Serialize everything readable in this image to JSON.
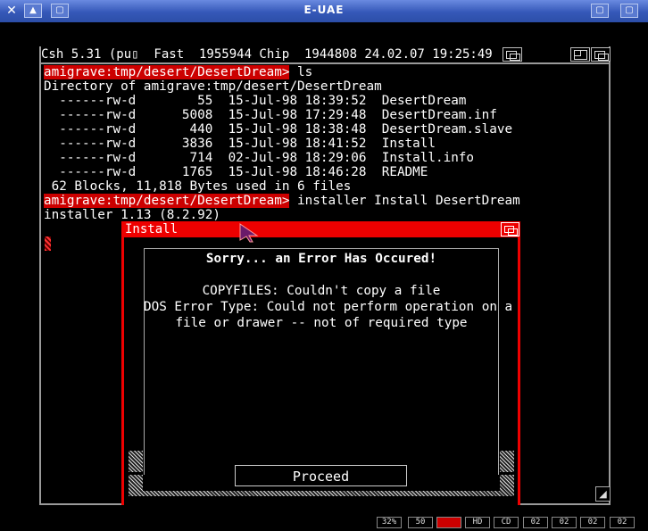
{
  "window": {
    "title": "E-UAE"
  },
  "shell": {
    "status_bar": "Csh 5.31 (pu▯  Fast  1955944 Chip  1944808 24.02.07 19:25:49",
    "lines": [
      {
        "prompt": "amigrave:tmp/desert/DesertDream>",
        "text": " ls"
      },
      {
        "prompt": "",
        "text": "Directory of amigrave:tmp/desert/DesertDream"
      },
      {
        "prompt": "",
        "text": "  ------rw-d        55  15-Jul-98 18:39:52  DesertDream"
      },
      {
        "prompt": "",
        "text": "  ------rw-d      5008  15-Jul-98 17:29:48  DesertDream.inf"
      },
      {
        "prompt": "",
        "text": "  ------rw-d       440  15-Jul-98 18:38:48  DesertDream.slave"
      },
      {
        "prompt": "",
        "text": "  ------rw-d      3836  15-Jul-98 18:41:52  Install"
      },
      {
        "prompt": "",
        "text": "  ------rw-d       714  02-Jul-98 18:29:06  Install.info"
      },
      {
        "prompt": "",
        "text": "  ------rw-d      1765  15-Jul-98 18:46:28  README"
      },
      {
        "prompt": "",
        "text": " 62 Blocks, 11,818 Bytes used in 6 files"
      },
      {
        "prompt": "amigrave:tmp/desert/DesertDream>",
        "text": " installer Install DesertDream"
      },
      {
        "prompt": "",
        "text": "installer 1.13 (8.2.92)"
      }
    ]
  },
  "requester": {
    "title": "Install",
    "heading": "Sorry... an Error Has Occured!",
    "message_lines": [
      "COPYFILES: Couldn't copy a file",
      "DOS Error Type: Could not perform operation on a",
      "file or drawer -- not of required type"
    ],
    "proceed_label": "Proceed"
  },
  "status_leds": [
    {
      "label": "32%",
      "color": "#000000"
    },
    {
      "label": "50",
      "color": "#000000"
    },
    {
      "label": "",
      "color": "#cc0000"
    },
    {
      "label": "HD",
      "color": "#000000"
    },
    {
      "label": "CD",
      "color": "#000000"
    },
    {
      "label": "02",
      "color": "#000000"
    },
    {
      "label": "02",
      "color": "#000000"
    },
    {
      "label": "02",
      "color": "#000000"
    },
    {
      "label": "02",
      "color": "#000000"
    }
  ],
  "colors": {
    "accent": "#e00000",
    "titlebar": "#3558b8"
  }
}
